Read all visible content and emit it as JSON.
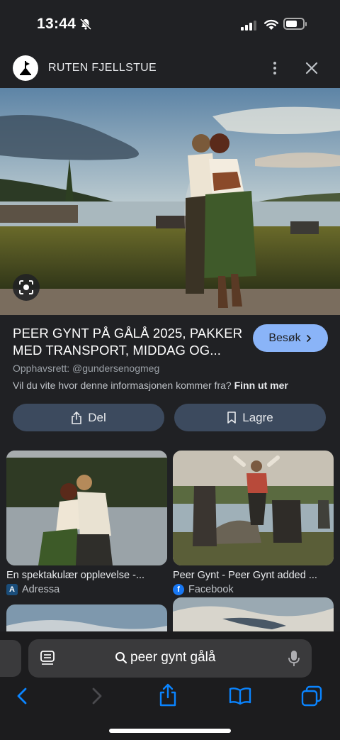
{
  "status": {
    "time": "13:44"
  },
  "header": {
    "site_name": "RUTEN FJELLSTUE"
  },
  "result": {
    "title": "PEER GYNT PÅ GÅLÅ 2025, PAKKER MED TRANSPORT, MIDDAG OG...",
    "visit_label": "Besøk",
    "copyright": "Opphavsrett: @gundersenogmeg",
    "info_prefix": "Vil du vite hvor denne informasjonen kommer fra?",
    "info_link": "Finn ut mer",
    "share_label": "Del",
    "save_label": "Lagre"
  },
  "related": [
    {
      "caption": "En spektakulær opplevelse -...",
      "source": "Adressa"
    },
    {
      "caption": "Peer Gynt - Peer Gynt added ...",
      "source": "Facebook"
    }
  ],
  "browser": {
    "address": "peer gynt gålå"
  },
  "colors": {
    "accent": "#8ab4f8",
    "button_bg": "#3c4a5e",
    "safari_blue": "#0a84ff"
  }
}
